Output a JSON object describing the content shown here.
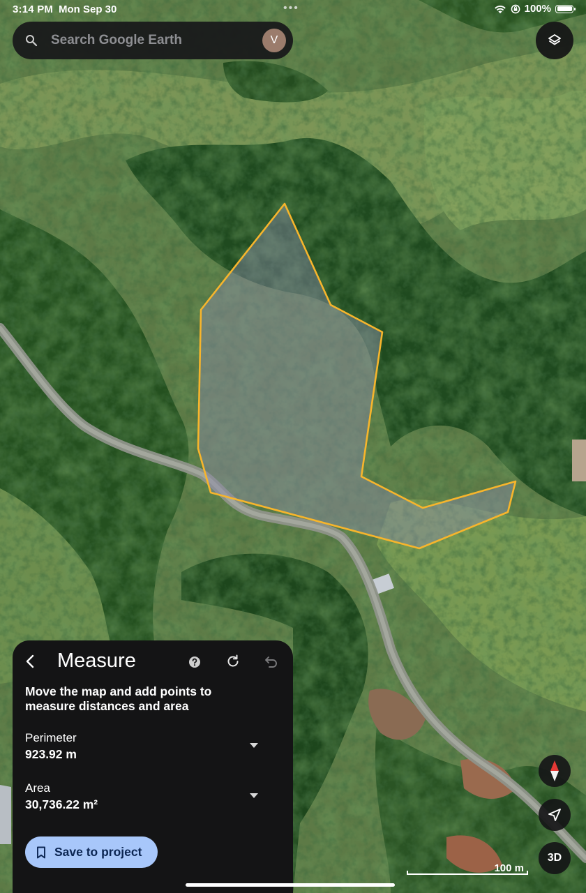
{
  "status_bar": {
    "time": "3:14 PM",
    "date": "Mon Sep 30",
    "battery": "100%",
    "dots": "•••"
  },
  "search": {
    "placeholder": "Search Google Earth",
    "avatar_initial": "V"
  },
  "measure_panel": {
    "title": "Measure",
    "instruction": "Move the map and add points to measure distances and area",
    "perimeter": {
      "label": "Perimeter",
      "value": "923.92 m"
    },
    "area": {
      "label": "Area",
      "value": "30,736.22 m²"
    },
    "save_label": "Save to project"
  },
  "map_controls": {
    "three_d_label": "3D",
    "scale_label": "100 m"
  },
  "colors": {
    "polygon_stroke": "#f7b52c",
    "panel_bg": "#141415",
    "save_button_bg": "#a8c7fa",
    "compass_north": "#e53935"
  },
  "icons": {
    "search": "search-icon",
    "layers": "layers-icon",
    "back": "chevron-left-icon",
    "help": "help-icon",
    "refresh": "refresh-icon",
    "undo": "undo-icon",
    "bookmark": "bookmark-icon",
    "compass": "compass-icon",
    "location": "location-arrow-icon",
    "wifi": "wifi-icon",
    "orientation_lock": "orientation-lock-icon",
    "battery": "battery-icon"
  }
}
